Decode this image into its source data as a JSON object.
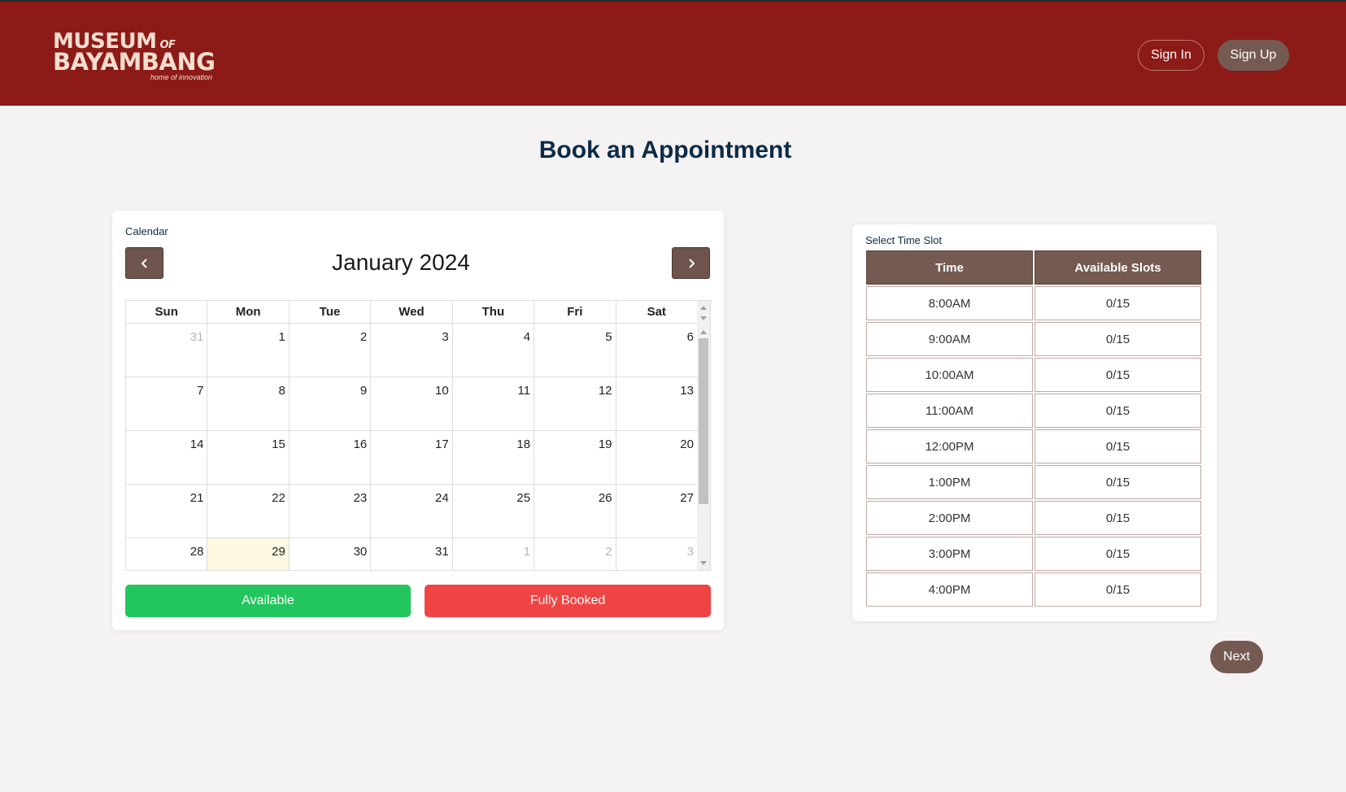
{
  "header": {
    "logo": {
      "line1": "MUSEUM",
      "of": "OF",
      "line2": "BAYAMBANG",
      "tagline": "home of innovation"
    },
    "sign_in": "Sign In",
    "sign_up": "Sign Up",
    "bg_color": "#8c1b18"
  },
  "page_title": "Book an Appointment",
  "calendar": {
    "label": "Calendar",
    "month": "January 2024",
    "prev_icon": "chevron-left-icon",
    "next_icon": "chevron-right-icon",
    "days_of_week": [
      "Sun",
      "Mon",
      "Tue",
      "Wed",
      "Thu",
      "Fri",
      "Sat"
    ],
    "weeks": [
      [
        "31",
        "1",
        "2",
        "3",
        "4",
        "5",
        "6"
      ],
      [
        "7",
        "8",
        "9",
        "10",
        "11",
        "12",
        "13"
      ],
      [
        "14",
        "15",
        "16",
        "17",
        "18",
        "19",
        "20"
      ],
      [
        "21",
        "22",
        "23",
        "24",
        "25",
        "26",
        "27"
      ],
      [
        "28",
        "29",
        "30",
        "31",
        "1",
        "2",
        "3"
      ]
    ],
    "highlighted_date": "29",
    "legend": {
      "available": "Available",
      "fully_booked": "Fully Booked"
    },
    "colors": {
      "available": "#22c55e",
      "fully_booked": "#ef4444",
      "today": "#fdf8e1"
    }
  },
  "time_slots": {
    "label": "Select Time Slot",
    "headers": [
      "Time",
      "Available Slots"
    ],
    "rows": [
      [
        "8:00AM",
        "0/15"
      ],
      [
        "9:00AM",
        "0/15"
      ],
      [
        "10:00AM",
        "0/15"
      ],
      [
        "11:00AM",
        "0/15"
      ],
      [
        "12:00PM",
        "0/15"
      ],
      [
        "1:00PM",
        "0/15"
      ],
      [
        "2:00PM",
        "0/15"
      ],
      [
        "3:00PM",
        "0/15"
      ],
      [
        "4:00PM",
        "0/15"
      ]
    ]
  },
  "next_button": "Next",
  "accent_color": "#755a52"
}
